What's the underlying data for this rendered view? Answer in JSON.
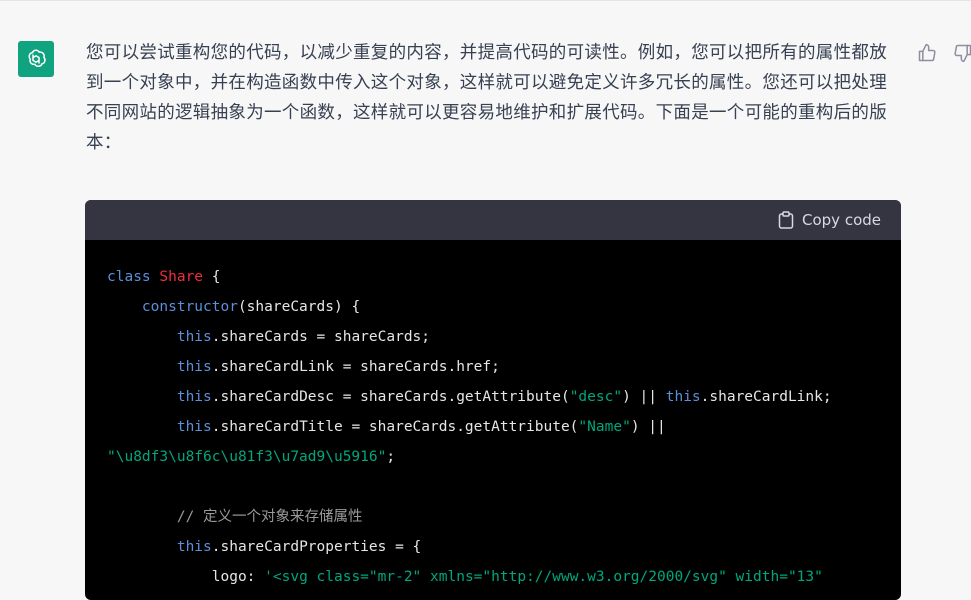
{
  "message": {
    "text": "您可以尝试重构您的代码，以减少重复的内容，并提高代码的可读性。例如，您可以把所有的属性都放到一个对象中，并在构造函数中传入这个对象，这样就可以避免定义许多冗长的属性。您还可以把处理不同网站的逻辑抽象为一个函数，这样就可以更容易地维护和扩展代码。下面是一个可能的重构后的版本："
  },
  "code": {
    "copy_label": "Copy code",
    "line1": {
      "kw": "class",
      "cls": "Share",
      "rest": " {"
    },
    "line2": {
      "indent": "    ",
      "fn": "constructor",
      "rest": "(shareCards) {"
    },
    "line3": {
      "indent": "        ",
      "kw": "this",
      "rest": ".shareCards = shareCards;"
    },
    "line4": {
      "indent": "        ",
      "kw": "this",
      "rest": ".shareCardLink = shareCards.href;"
    },
    "line5": {
      "indent": "        ",
      "kw": "this",
      "mid": ".shareCardDesc = shareCards.getAttribute(",
      "str": "\"desc\"",
      "mid2": ") || ",
      "kw2": "this",
      "rest": ".shareCardLink;"
    },
    "line6": {
      "indent": "        ",
      "kw": "this",
      "mid": ".shareCardTitle = shareCards.getAttribute(",
      "str": "\"Name\"",
      "rest": ") ||"
    },
    "line7": {
      "str": "\"\\u8df3\\u8f6c\\u81f3\\u7ad9\\u5916\"",
      "rest": ";"
    },
    "line8": "",
    "line9": {
      "indent": "        ",
      "comment": "// 定义一个对象来存储属性"
    },
    "line10": {
      "indent": "        ",
      "kw": "this",
      "rest": ".shareCardProperties = {"
    },
    "line11": {
      "indent": "            ",
      "mid": "logo: ",
      "str": "'<svg class=\"mr-2\" xmlns=\"http://www.w3.org/2000/svg\" width=\"13\""
    }
  },
  "colors": {
    "avatar": "#10a37f",
    "code_bg": "#000000",
    "code_header": "#343541",
    "keyword": "#5d8fd9",
    "class_name": "#f22c3d",
    "string": "#00a67d",
    "comment": "#9a9a9a"
  },
  "icons": {
    "avatar": "openai-logo-icon",
    "copy": "clipboard-icon",
    "thumbs_up": "thumbs-up-icon",
    "thumbs_down": "thumbs-down-icon"
  }
}
